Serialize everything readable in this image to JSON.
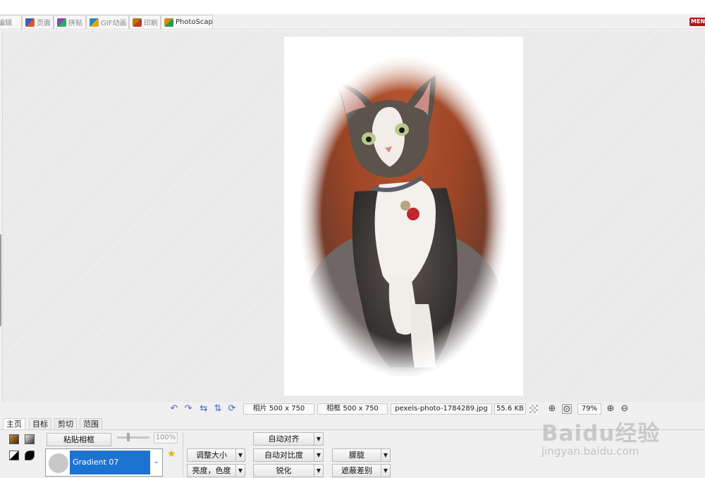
{
  "tabs": [
    {
      "label": "编辑",
      "icon": "edit-tab-icon"
    },
    {
      "label": "页面",
      "icon": "page-tab-icon"
    },
    {
      "label": "拼贴",
      "icon": "combine-tab-icon"
    },
    {
      "label": "GIF动画",
      "icon": "gif-tab-icon"
    },
    {
      "label": "印刷",
      "icon": "print-tab-icon"
    },
    {
      "label": "PhotoScape",
      "icon": "photoscape-tab-icon"
    }
  ],
  "menu_label": "MENU",
  "status": {
    "photo_size": "相片 500 x 750",
    "frame_size": "相框 500 x 750",
    "filename": "pexels-photo-1784289.jpg",
    "filesize": "55.6 KB",
    "zoom": "79%"
  },
  "panel": {
    "tabs": [
      "主页",
      "目标",
      "剪切",
      "范围"
    ],
    "paste_frame": "粘贴相框",
    "opacity": "100%",
    "frame_name": "Gradient 07",
    "resize": "调整大小",
    "brightness": "亮度，色度",
    "auto_level": "自动对齐",
    "auto_contrast": "自动对比度",
    "sharpen": "锐化",
    "blur": "朦胧",
    "backlight": "遮蔽差别"
  },
  "watermark": {
    "brand": "Baidu经验",
    "url": "jingyan.baidu.com"
  },
  "colors": {
    "accent": "#1e73d2",
    "menu_badge": "#b3141b",
    "workspace": "#e8e8e8"
  }
}
